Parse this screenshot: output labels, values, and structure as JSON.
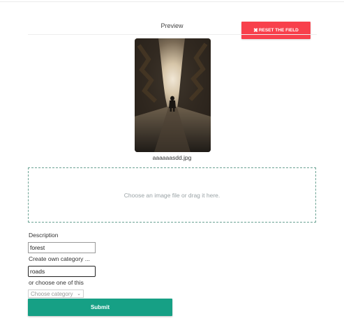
{
  "preview": {
    "title": "Preview",
    "reset_icon": "close-icon",
    "reset_label": "RESET THE FIELD",
    "image_description": "photo of a person standing on a forest road",
    "file_name": "aaaaaasdd.jpg"
  },
  "dropzone": {
    "text": "Choose an image file or drag it here."
  },
  "form": {
    "description_label": "Description",
    "description_value": "forest",
    "own_category_label": "Create own category ...",
    "own_category_value": "roads",
    "choose_label": "or choose one of this",
    "category_select": {
      "selected": "Choose category",
      "icon": "chevron-down-icon"
    },
    "submit_label": "Submit"
  },
  "colors": {
    "reset_button": "#f8404c",
    "submit_button": "#16a085",
    "dropzone_border": "#6ba293"
  }
}
